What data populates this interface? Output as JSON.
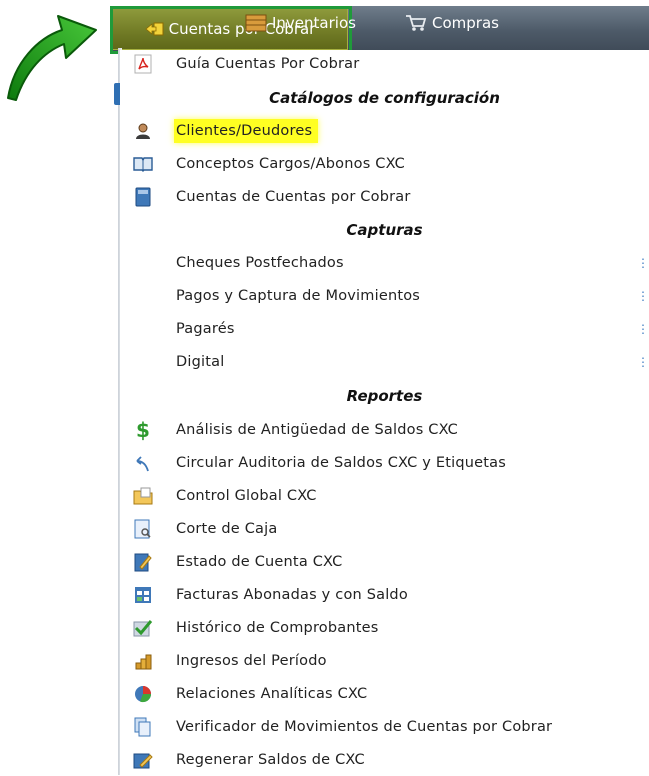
{
  "menu_bar": {
    "active": "Cuentas por Cobrar",
    "items": [
      "Cuentas por Cobrar",
      "Inventarios",
      "Compras"
    ]
  },
  "dropdown": {
    "guide": "Guía Cuentas Por Cobrar",
    "sections": [
      {
        "title": "Catálogos de configuración",
        "items": [
          "Clientes/Deudores",
          "Conceptos Cargos/Abonos CXC",
          "Cuentas de Cuentas por Cobrar"
        ]
      },
      {
        "title": "Capturas",
        "items": [
          "Cheques Postfechados",
          "Pagos y Captura de Movimientos",
          "Pagarés",
          "Digital"
        ]
      },
      {
        "title": "Reportes",
        "items": [
          "Análisis de Antigüedad de Saldos CXC",
          "Circular Auditoria de Saldos CXC y Etiquetas",
          "Control Global CXC",
          "Corte de Caja",
          "Estado de Cuenta CXC",
          "Facturas Abonadas y con Saldo",
          "Histórico de Comprobantes",
          "Ingresos del Período",
          "Relaciones Analíticas CXC",
          "Verificador de Movimientos de Cuentas por Cobrar",
          "Regenerar Saldos de CXC"
        ]
      }
    ],
    "highlighted_item": "Clientes/Deudores"
  },
  "colors": {
    "highlight": "#ffff22",
    "active_frame": "#1f9a3a",
    "arrow": "#1e9a1e"
  }
}
